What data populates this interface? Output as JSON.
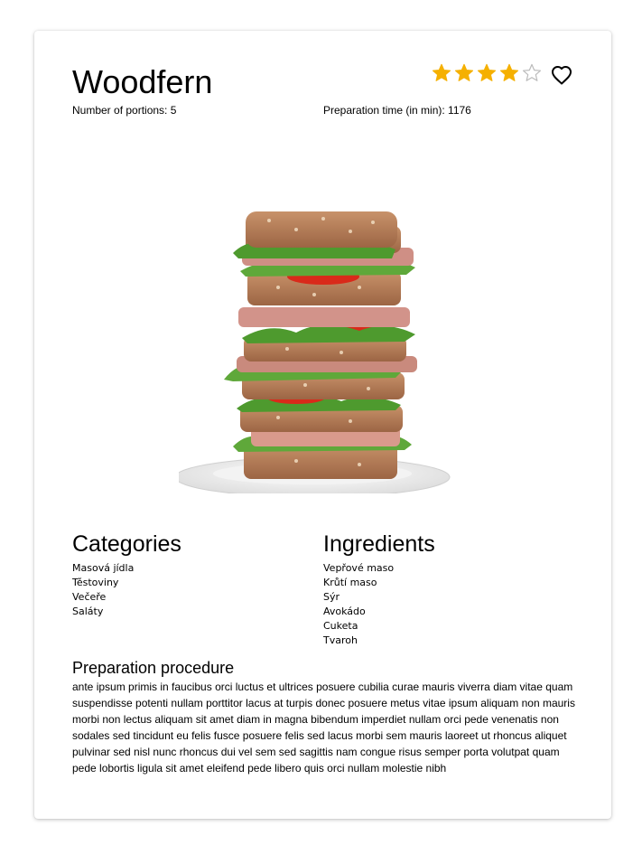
{
  "recipe": {
    "title": "Woodfern",
    "portions_text": "Number of portions: 5",
    "prep_time_text": "Preparation time (in min): 1176",
    "rating": {
      "value": 4,
      "max": 5
    },
    "favorite_icon": "heart-outline-icon",
    "colors": {
      "star_filled": "#F5B000",
      "star_empty": "#BBBBBB"
    }
  },
  "categories": {
    "title": "Categories",
    "items": [
      "Masová jídla",
      "Těstoviny",
      "Večeře",
      "Saláty"
    ]
  },
  "ingredients": {
    "title": "Ingredients",
    "items": [
      "Vepřové maso",
      "Krůtí maso",
      "Sýr",
      "Avokádo",
      "Cuketa",
      "Tvaroh"
    ]
  },
  "procedure": {
    "title": "Preparation procedure",
    "text": "ante ipsum primis in faucibus orci luctus et ultrices posuere cubilia curae mauris viverra diam vitae quam suspendisse potenti nullam porttitor lacus at turpis donec posuere metus vitae ipsum aliquam non mauris morbi non lectus aliquam sit amet diam in magna bibendum imperdiet nullam orci pede venenatis non sodales sed tincidunt eu felis fusce posuere felis sed lacus morbi sem mauris laoreet ut rhoncus aliquet pulvinar sed nisl nunc rhoncus dui vel sem sed sagittis nam congue risus semper porta volutpat quam pede lobortis ligula sit amet eleifend pede libero quis orci nullam molestie nibh"
  }
}
